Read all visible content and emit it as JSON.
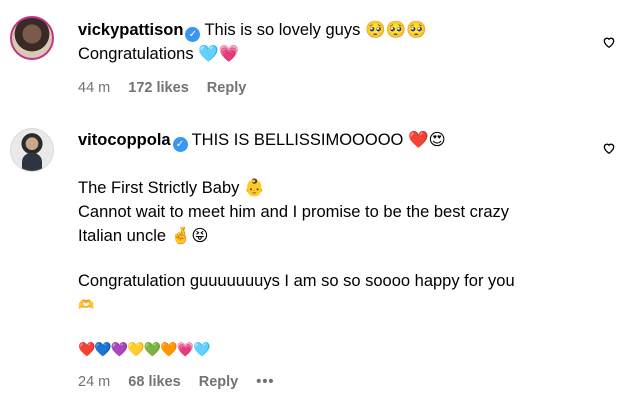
{
  "comments": [
    {
      "username": "vickypattison",
      "text": "This is so lovely guys 🥺🥺🥺",
      "lines": [
        "Congratulations 🩵💗"
      ],
      "time": "44 m",
      "likes": "172 likes",
      "reply": "Reply"
    },
    {
      "username": "vitocoppola",
      "text": "THIS IS BELLISSIMOOOOO ❤️😍",
      "lines": [
        "The First Strictly Baby 👶",
        "Cannot wait to meet him and I promise to be the best crazy",
        "Italian uncle 🤞😝",
        "Congratulation guuuuuuuys I am so so soooo happy for you",
        "🫶",
        "❤️💙💜💛💚🧡💗🩵"
      ],
      "time": "24 m",
      "likes": "68 likes",
      "reply": "Reply",
      "more": "•••"
    }
  ],
  "icons": {
    "verified": "verified-badge-icon",
    "like": "heart-outline-icon",
    "options": "more-options-icon"
  },
  "colors": {
    "verified": "#3897f0",
    "meta": "#737373"
  }
}
